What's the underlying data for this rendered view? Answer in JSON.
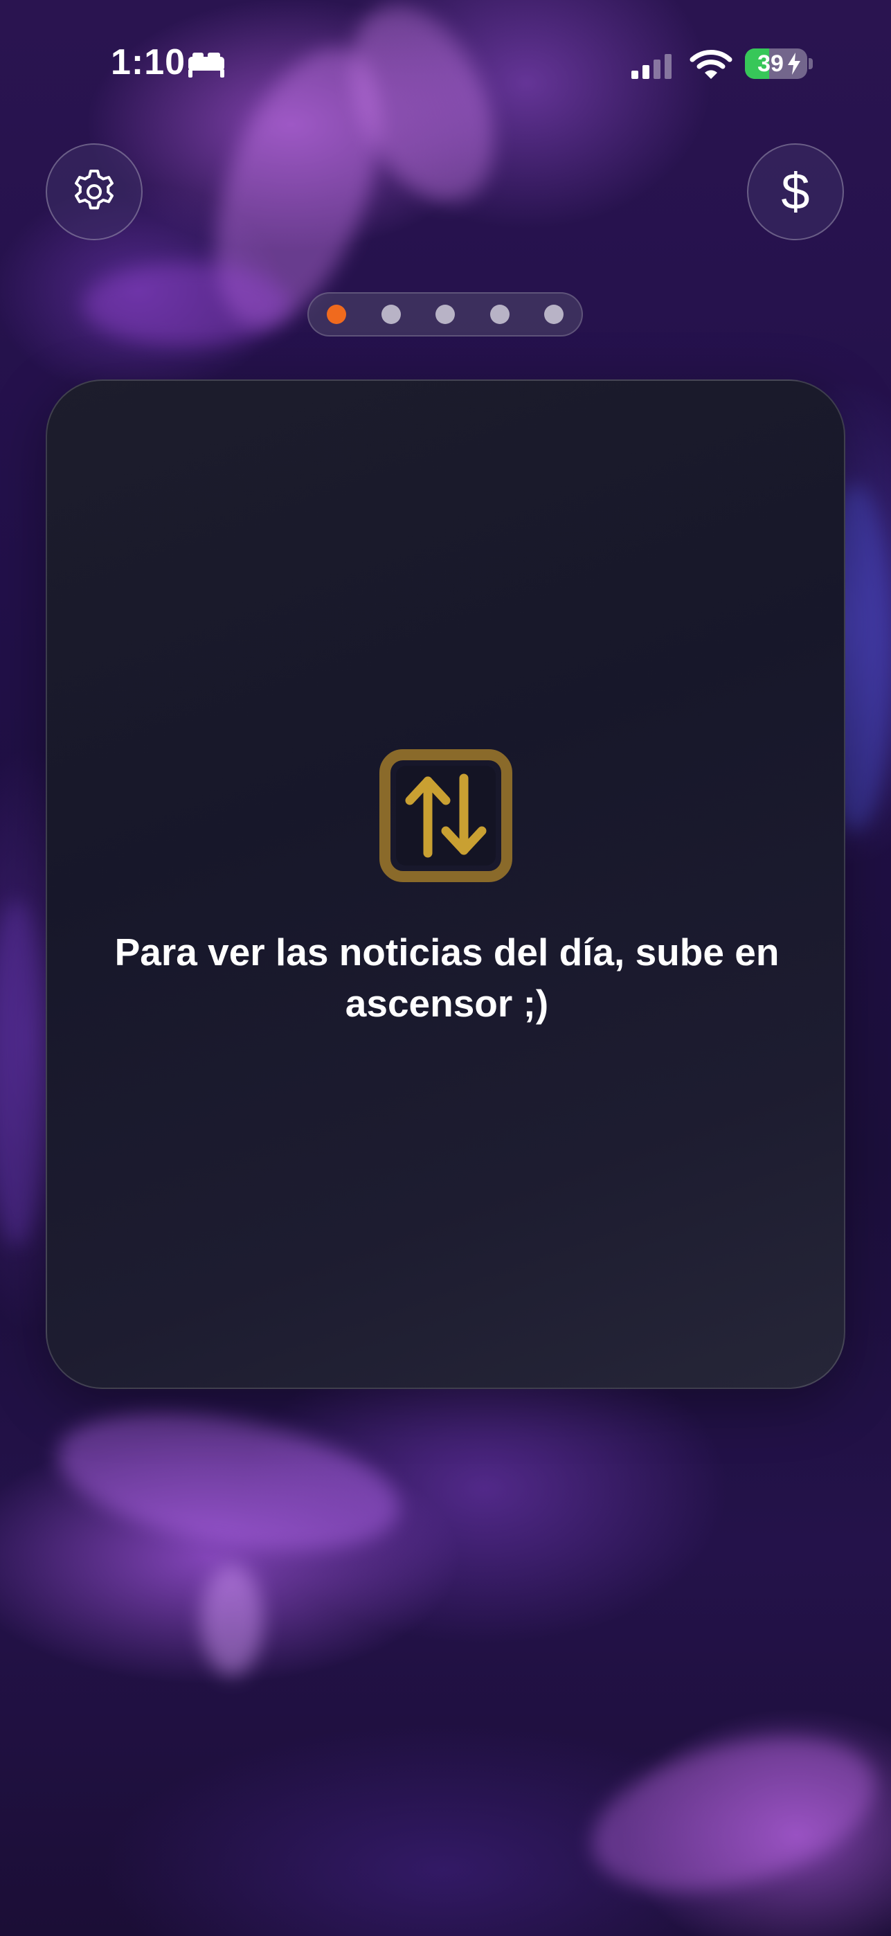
{
  "status_bar": {
    "time": "1:10",
    "focus_icon": "bed-icon",
    "signal_icon": "cellular-signal-icon",
    "wifi_icon": "wifi-icon",
    "battery_level": "39",
    "battery_fraction": 0.39,
    "battery_charging": true,
    "battery_color": "#37c759"
  },
  "header": {
    "settings_icon": "gear-icon",
    "currency_symbol": "$"
  },
  "pager": {
    "count": 5,
    "active_index": 0,
    "active_color": "#f06a1e",
    "inactive_color": "#b8b3c6"
  },
  "card": {
    "icon": "elevator-up-down-icon",
    "icon_color": "#c9a032",
    "message": "Para ver las noticias del día, sube en ascensor ;)"
  }
}
